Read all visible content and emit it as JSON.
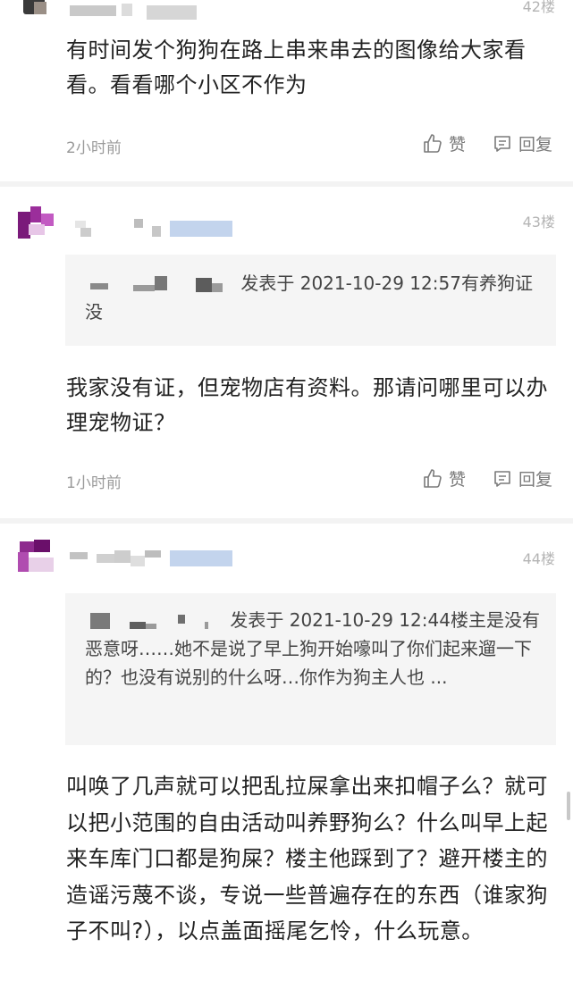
{
  "posts": [
    {
      "floor": "42楼",
      "body": "有时间发个狗狗在路上串来串去的图像给大家看看。看看哪个小区不作为",
      "time": "2小时前",
      "like_label": "赞",
      "reply_label": "回复"
    },
    {
      "floor": "43楼",
      "quote_prefix": "发表于 2021-10-29 12:57",
      "quote_text": "有养狗证没",
      "body": "我家没有证，但宠物店有资料。那请问哪里可以办理宠物证？",
      "time": "1小时前",
      "like_label": "赞",
      "reply_label": "回复"
    },
    {
      "floor": "44楼",
      "quote_prefix": "发表于 2021-10-29 12:44",
      "quote_text": "楼主是没有恶意呀……她不是说了早上狗开始嚎叫了你们起来遛一下的？也没有说别的什么呀…你作为狗主人也 ...",
      "body": "叫唤了几声就可以把乱拉屎拿出来扣帽子么？就可以把小范围的自由活动叫养野狗么？什么叫早上起来车库门口都是狗屎？楼主他踩到了？避开楼主的造谣污蔑不谈，专说一些普遍存在的东西（谁家狗子不叫?），以点盖面摇尾乞怜，什么玩意。"
    }
  ],
  "icons": {
    "like": "thumbs-up-icon",
    "reply": "comment-icon"
  },
  "colors": {
    "text": "#222222",
    "meta": "#9a9a9a",
    "quote_bg": "#f5f5f5",
    "divider": "#f3f3f3",
    "badge": "#b8ccea"
  }
}
